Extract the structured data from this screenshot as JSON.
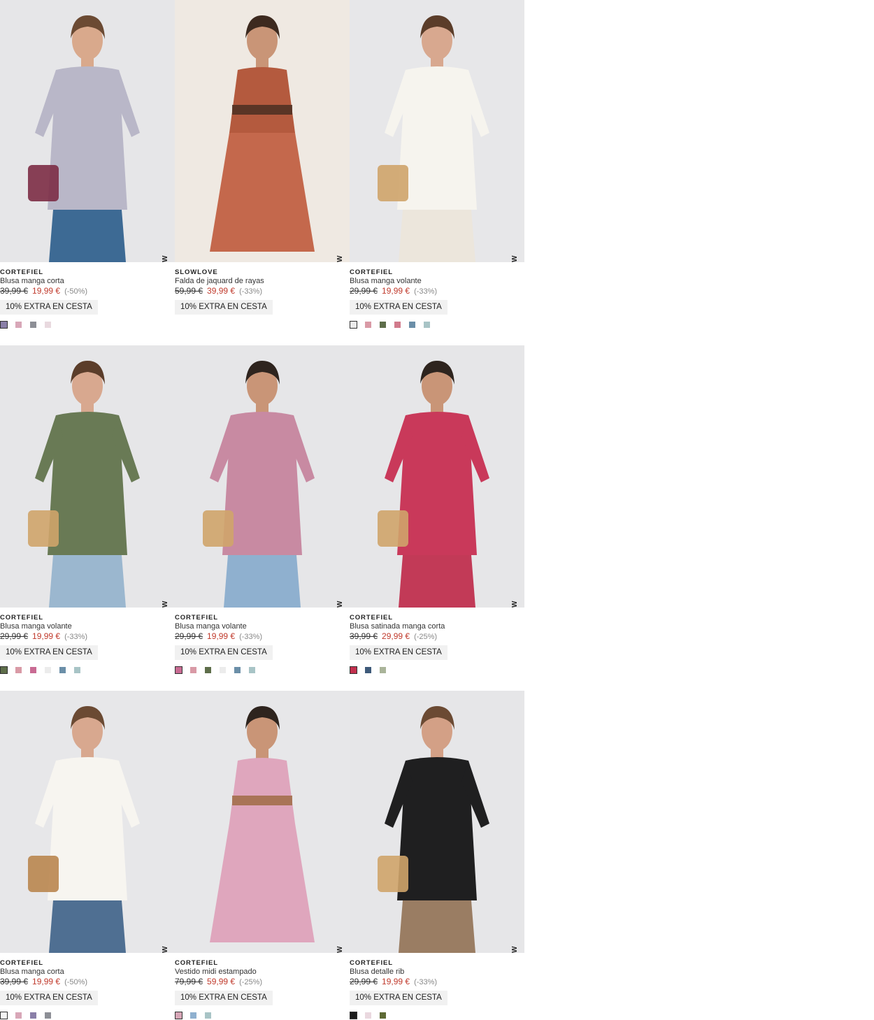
{
  "extra_label": "10% EXTRA EN CESTA",
  "new_label": "NEW",
  "products": [
    {
      "brand": "CORTEFIEL",
      "name": "Blusa manga corta",
      "old_price": "39,99 €",
      "price": "19,99 €",
      "discount": "(-50%)",
      "swatches": [
        "#8a7fa8",
        "#d8a7b8",
        "#8d8f96",
        "#e9d9df"
      ],
      "image": {
        "bg": "#e6e6e8",
        "top": "#b9b7c8",
        "bottom": "#3d6a94",
        "skin": "#d9a98c",
        "hair": "#6b4a33",
        "accessory": "#7c2c45"
      }
    },
    {
      "brand": "SLOWLOVE",
      "name": "Falda de jaquard de rayas",
      "old_price": "59,99 €",
      "price": "39,99 €",
      "discount": "(-33%)",
      "swatches": [],
      "image": {
        "bg": "#efe9e2",
        "top": "#b45a3e",
        "bottom": "#c4684c",
        "skin": "#c99577",
        "hair": "#3d2a1f",
        "accessory": "#4a2f22"
      }
    },
    {
      "brand": "CORTEFIEL",
      "name": "Blusa manga volante",
      "old_price": "29,99 €",
      "price": "19,99 €",
      "discount": "(-33%)",
      "swatches": [
        "#ececec",
        "#d99aa6",
        "#5e6e4a",
        "#d17b8c",
        "#6b8fa8",
        "#a8c4c6"
      ],
      "image": {
        "bg": "#e7e7e9",
        "top": "#f6f4ee",
        "bottom": "#ece6dc",
        "skin": "#d8a88f",
        "hair": "#5b3d2a",
        "accessory": "#cfa46a"
      }
    },
    {
      "brand": "CORTEFIEL",
      "name": "Blusa manga volante",
      "old_price": "29,99 €",
      "price": "19,99 €",
      "discount": "(-33%)",
      "swatches": [
        "#5e6e4a",
        "#d99aa6",
        "#c96b93",
        "#ececec",
        "#6b8fa8",
        "#a8c4c6"
      ],
      "image": {
        "bg": "#e6e6e8",
        "top": "#697a55",
        "bottom": "#9bb7cf",
        "skin": "#d8a88f",
        "hair": "#5b3d2a",
        "accessory": "#cfa46a"
      }
    },
    {
      "brand": "CORTEFIEL",
      "name": "Blusa manga volante",
      "old_price": "29,99 €",
      "price": "19,99 €",
      "discount": "(-33%)",
      "swatches": [
        "#c96b93",
        "#d99aa6",
        "#5e6e4a",
        "#ececec",
        "#6b8fa8",
        "#a8c4c6"
      ],
      "image": {
        "bg": "#e6e6e8",
        "top": "#c88aa2",
        "bottom": "#8fb0cf",
        "skin": "#c99577",
        "hair": "#2e241e",
        "accessory": "#cfa46a"
      }
    },
    {
      "brand": "CORTEFIEL",
      "name": "Blusa satinada manga corta",
      "old_price": "39,99 €",
      "price": "29,99 €",
      "discount": "(-25%)",
      "swatches": [
        "#c2304e",
        "#3e5a7a",
        "#aab49a"
      ],
      "image": {
        "bg": "#e6e6e8",
        "top": "#c9395a",
        "bottom": "#c23a57",
        "skin": "#c99577",
        "hair": "#2e241e",
        "accessory": "#cfa46a"
      }
    },
    {
      "brand": "CORTEFIEL",
      "name": "Blusa manga corta",
      "old_price": "39,99 €",
      "price": "19,99 €",
      "discount": "(-50%)",
      "swatches": [
        "#f4f4f4",
        "#d8a7b8",
        "#8a7fa8",
        "#8d8f96"
      ],
      "image": {
        "bg": "#e7e7e9",
        "top": "#f7f5f0",
        "bottom": "#4f6f92",
        "skin": "#d8a88f",
        "hair": "#6b4a33",
        "accessory": "#b9864f"
      }
    },
    {
      "brand": "CORTEFIEL",
      "name": "Vestido midi estampado",
      "old_price": "79,99 €",
      "price": "59,99 €",
      "discount": "(-25%)",
      "swatches": [
        "#d8a7b8",
        "#8fb0cf",
        "#a8c4c6"
      ],
      "image": {
        "bg": "#e7e7e9",
        "top": "#dfa6bd",
        "bottom": "#dfa6bd",
        "skin": "#c99577",
        "hair": "#2e241e",
        "accessory": "#a06b45"
      }
    },
    {
      "brand": "CORTEFIEL",
      "name": "Blusa detalle rib",
      "old_price": "29,99 €",
      "price": "19,99 €",
      "discount": "(-33%)",
      "swatches": [
        "#1c1c1c",
        "#ead8df",
        "#5e6a35"
      ],
      "image": {
        "bg": "#e6e6e8",
        "top": "#1f1f20",
        "bottom": "#9a7d63",
        "skin": "#d3a086",
        "hair": "#6b4a33",
        "accessory": "#cfa46a"
      }
    }
  ]
}
